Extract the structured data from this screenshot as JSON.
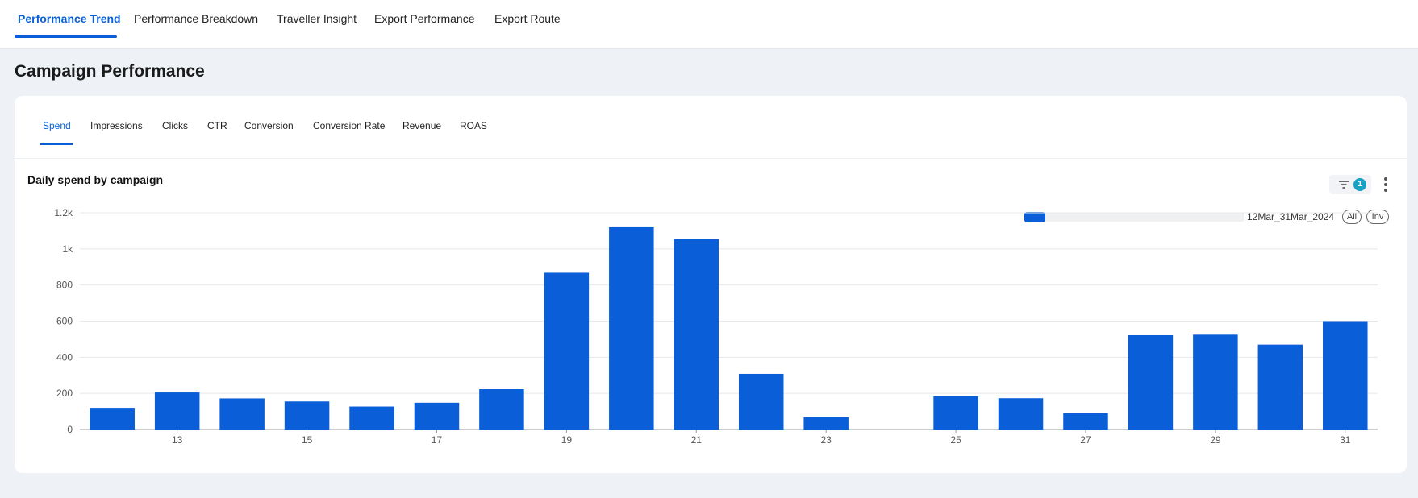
{
  "topnav": {
    "tabs": [
      {
        "label": "Performance Trend",
        "active": true
      },
      {
        "label": "Performance Breakdown"
      },
      {
        "label": "Traveller Insight"
      },
      {
        "label": "Export Performance"
      },
      {
        "label": "Export Route"
      }
    ]
  },
  "page": {
    "title": "Campaign Performance"
  },
  "metrics": {
    "tabs": [
      {
        "label": "Spend",
        "active": true
      },
      {
        "label": "Impressions"
      },
      {
        "label": "Clicks"
      },
      {
        "label": "CTR"
      },
      {
        "label": "Conversion"
      },
      {
        "label": "Conversion Rate"
      },
      {
        "label": "Revenue"
      },
      {
        "label": "ROAS"
      }
    ]
  },
  "chart_header": {
    "title": "Daily spend by campaign",
    "filter_count": "1",
    "filter_icon": "filter-icon",
    "more_icon": "more-vertical-icon"
  },
  "legend": {
    "series_label": "12Mar_31Mar_2024",
    "all_label": "All",
    "inv_label": "Inv",
    "color": "#0a5fd8"
  },
  "chart_data": {
    "type": "bar",
    "title": "Daily spend by campaign",
    "x": [
      12,
      13,
      14,
      15,
      16,
      17,
      18,
      19,
      20,
      21,
      22,
      23,
      24,
      25,
      26,
      27,
      28,
      29,
      30,
      31
    ],
    "x_tick_labels": [
      "13",
      "15",
      "17",
      "19",
      "21",
      "23",
      "25",
      "27",
      "29",
      "31"
    ],
    "series": [
      {
        "name": "12Mar_31Mar_2024",
        "color": "#0a5fd8",
        "values": [
          120,
          205,
          172,
          155,
          127,
          148,
          223,
          868,
          1120,
          1055,
          308,
          68,
          0,
          183,
          173,
          92,
          522,
          525,
          470,
          600
        ]
      }
    ],
    "y_ticks": [
      0,
      200,
      400,
      600,
      800,
      1000,
      1200
    ],
    "y_tick_labels": [
      "0",
      "200",
      "400",
      "600",
      "800",
      "1k",
      "1.2k"
    ],
    "ylim": [
      0,
      1200
    ],
    "grid": true,
    "legend_position": "top-right"
  }
}
